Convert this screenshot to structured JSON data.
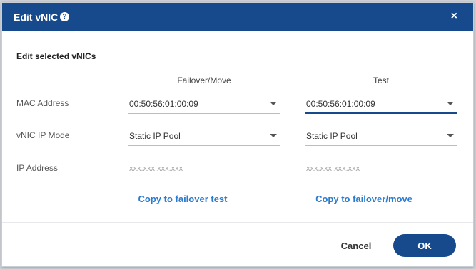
{
  "dialog": {
    "title": "Edit vNIC",
    "help_icon": "question-circle-icon",
    "close_icon": "close-icon",
    "close_glyph": "×",
    "help_glyph": "?"
  },
  "section_heading": "Edit selected vNICs",
  "columns": {
    "failover": "Failover/Move",
    "test": "Test"
  },
  "rows": {
    "mac_label": "MAC Address",
    "mode_label": "vNIC IP Mode",
    "ip_label": "IP Address"
  },
  "failover": {
    "mac_value": "00:50:56:01:00:09",
    "mode_value": "Static IP Pool",
    "ip_placeholder": "xxx.xxx.xxx.xxx",
    "copy_link": "Copy to failover test"
  },
  "test": {
    "mac_value": "00:50:56:01:00:09",
    "mode_value": "Static IP Pool",
    "ip_placeholder": "xxx.xxx.xxx.xxx",
    "copy_link": "Copy to failover/move"
  },
  "footer": {
    "cancel_label": "Cancel",
    "ok_label": "OK"
  },
  "colors": {
    "primary": "#174a8c",
    "link": "#2a7bd0"
  }
}
